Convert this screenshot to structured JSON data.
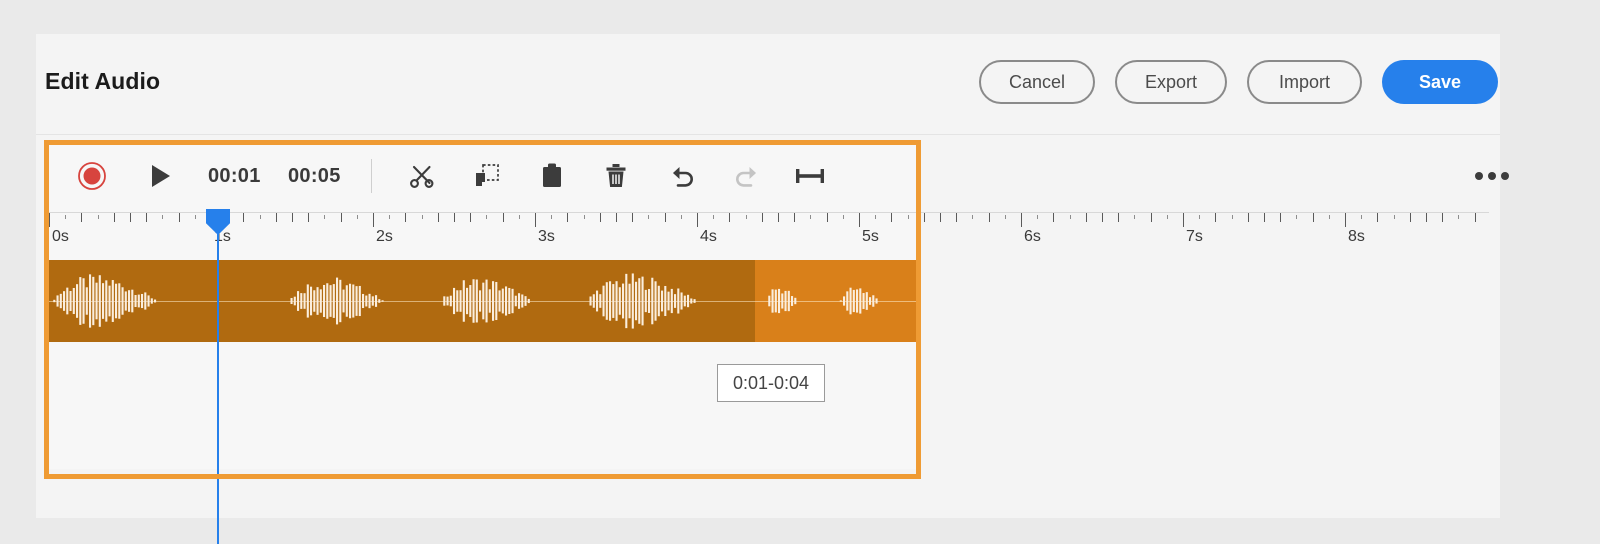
{
  "header": {
    "title": "Edit Audio",
    "actions": [
      {
        "label": "Cancel",
        "name": "cancel-button",
        "style": "outline"
      },
      {
        "label": "Export",
        "name": "export-button",
        "style": "outline"
      },
      {
        "label": "Import",
        "name": "import-button",
        "style": "outline"
      },
      {
        "label": "Save",
        "name": "save-button",
        "style": "primary"
      }
    ]
  },
  "toolbar": {
    "record_icon": "record-icon",
    "play_icon": "play-icon",
    "current_time": "00:01",
    "total_time": "00:05",
    "tools": [
      {
        "name": "cut-button",
        "icon": "scissors-icon",
        "enabled": true
      },
      {
        "name": "copy-button",
        "icon": "copy-icon",
        "enabled": true
      },
      {
        "name": "paste-button",
        "icon": "paste-icon",
        "enabled": true
      },
      {
        "name": "delete-button",
        "icon": "trash-icon",
        "enabled": true
      },
      {
        "name": "undo-button",
        "icon": "undo-icon",
        "enabled": true
      },
      {
        "name": "redo-button",
        "icon": "redo-icon",
        "enabled": false
      },
      {
        "name": "range-button",
        "icon": "range-icon",
        "enabled": true
      }
    ],
    "more_icon": "more-horizontal-icon"
  },
  "ruler": {
    "labels": [
      "0s",
      "1s",
      "2s",
      "3s",
      "4s",
      "5s",
      "6s",
      "7s",
      "8s"
    ],
    "seconds_span": 162,
    "subdivisions": 10
  },
  "timeline": {
    "clip_duration_label": "00:05",
    "selection_label": "0:01-0:04",
    "playhead_time": "00:01"
  },
  "colors": {
    "accent_blue": "#2680eb",
    "highlight_orange": "#ef9b34",
    "clip_orange": "#d9801a",
    "selection_orange": "#b06a10",
    "record_red": "#d7443e",
    "panel_bg": "#f4f4f4",
    "page_bg": "#eaeaea"
  }
}
